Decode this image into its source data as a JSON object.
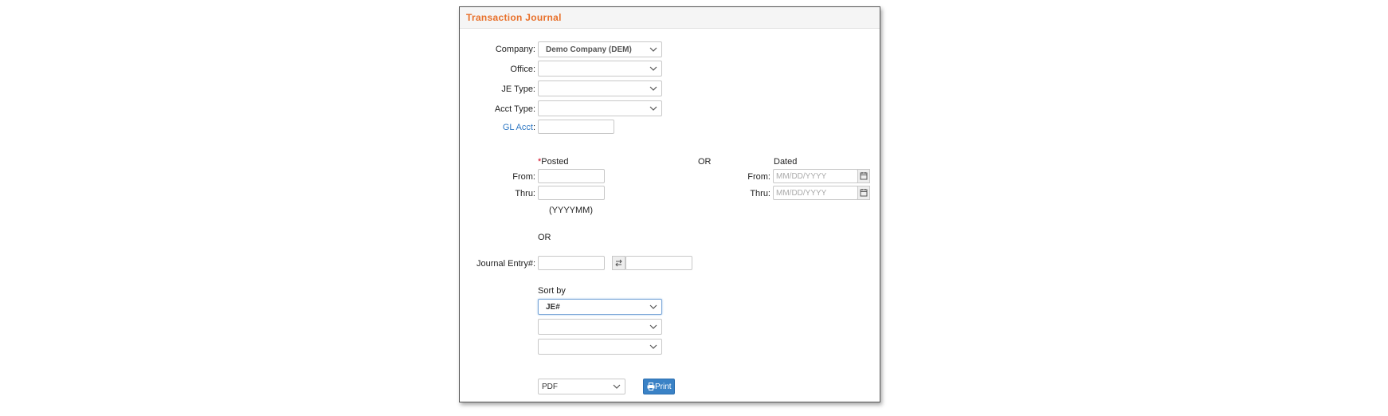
{
  "panel": {
    "title": "Transaction Journal"
  },
  "form": {
    "company_label": "Company:",
    "company_value": "Demo Company (DEM)",
    "office_label": "Office:",
    "je_type_label": "JE Type:",
    "acct_type_label": "Acct Type:",
    "gl_acct_label": "GL Acct",
    "gl_acct_colon": ":"
  },
  "posted": {
    "required_mark": "*",
    "heading": "Posted",
    "from_label": "From:",
    "thru_label": "Thru:",
    "format_hint": "(YYYYMM)"
  },
  "or_label_1": "OR",
  "dated": {
    "heading": "Dated",
    "from_label": "From:",
    "thru_label": "Thru:",
    "from_placeholder": "MM/DD/YYYY",
    "thru_placeholder": "MM/DD/YYYY"
  },
  "or_label_2": "OR",
  "journal_entry": {
    "label": "Journal Entry#:"
  },
  "sort": {
    "heading": "Sort by",
    "sort1_value": "JE#",
    "sort2_value": "",
    "sort3_value": ""
  },
  "output": {
    "format_value": "PDF",
    "print_label": "Print"
  }
}
